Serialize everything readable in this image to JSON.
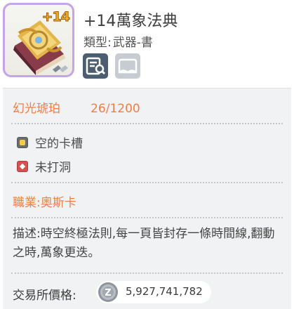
{
  "item": {
    "level_badge": "+14",
    "name": "+14萬象法典",
    "type_label": "類型:",
    "type_value": "武器-書",
    "icons": [
      "compare-icon",
      "wardrobe-icon"
    ]
  },
  "refine": {
    "label": "幻光琥珀",
    "value": "26/1200"
  },
  "slots": [
    {
      "icon": "card-slot-icon",
      "label": "空的卡槽"
    },
    {
      "icon": "socket-icon",
      "label": "未打洞"
    }
  ],
  "job": "職業:奧斯卡",
  "description": "描述:時空終極法則,每一頁皆封存一條時間線,翻動之時,萬象更迭。",
  "exchange": {
    "label": "交易所價格:",
    "currency_icon": "zeny-coin-icon",
    "price": "5,927,741,782"
  },
  "colors": {
    "accent_orange": "#ef7f45",
    "frame_purple": "#c7a3ea",
    "panel_bg": "#f1f2f3"
  }
}
